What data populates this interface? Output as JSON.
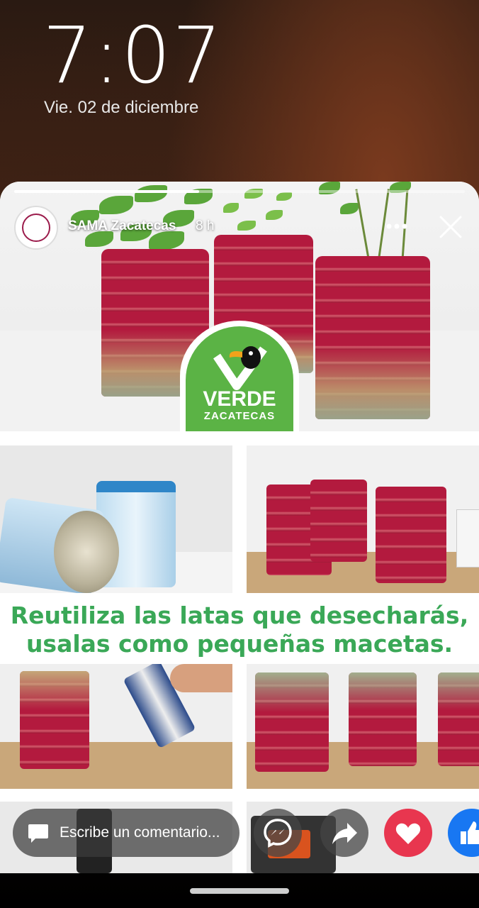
{
  "lock_screen": {
    "time": "7:07",
    "date": "Vie. 02 de diciembre"
  },
  "story": {
    "page_name": "SAMA Zacatecas",
    "post_time": "8 h",
    "progress": 0.41,
    "logo": {
      "brand_line1": "VERDE",
      "brand_line2": "ZACATECAS",
      "color": "#5bb345"
    },
    "caption": {
      "line1": "Reutiliza las latas que desecharás,",
      "line2": "usalas como pequeñas macetas.",
      "color": "#3aa857"
    }
  },
  "controls": {
    "comment_placeholder": "Escribe un comentario...",
    "icons": [
      "messenger-icon",
      "share-icon",
      "love-reaction-icon",
      "like-reaction-icon"
    ],
    "colors": {
      "love": "#e8364f",
      "like": "#1877f2"
    }
  }
}
